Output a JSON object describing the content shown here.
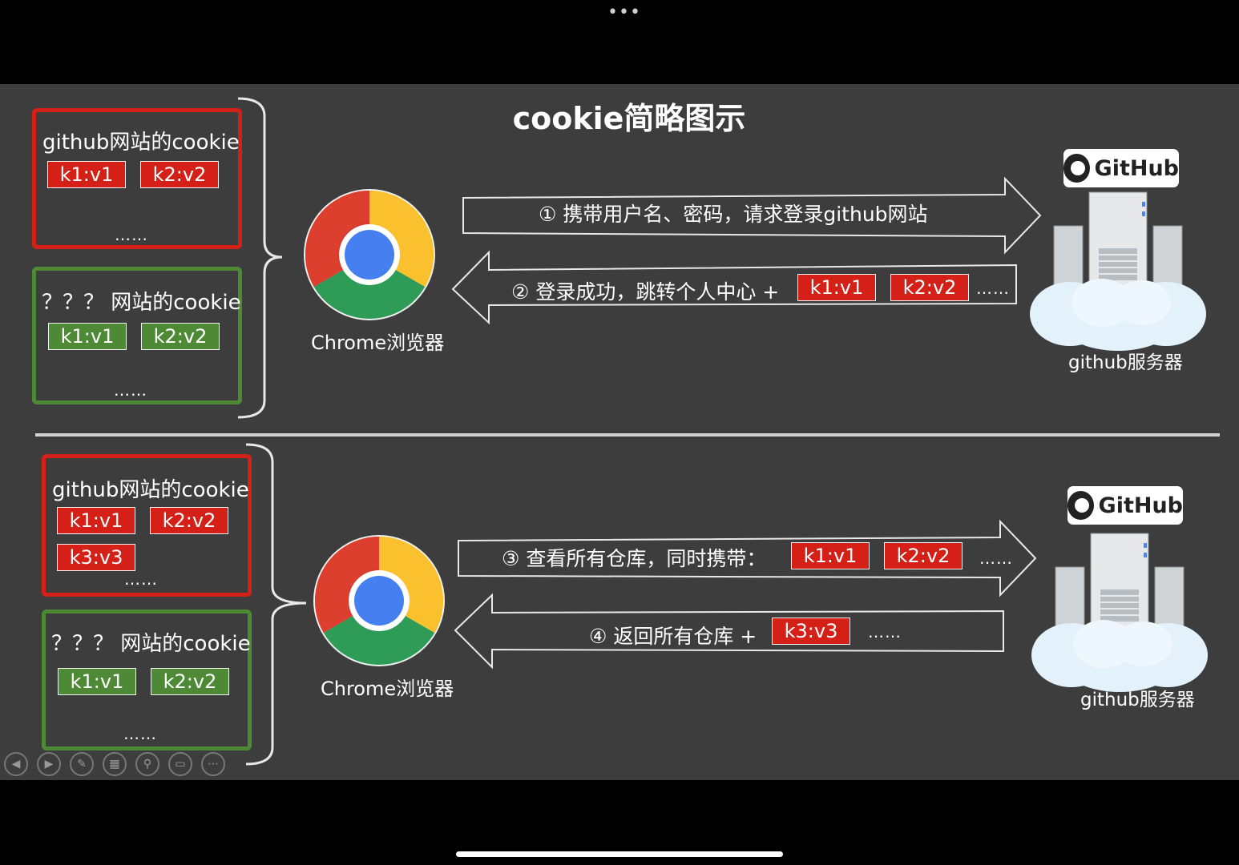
{
  "header": {
    "dots": "•••"
  },
  "slide": {
    "title": "cookie简略图示"
  },
  "top": {
    "github_cookie": {
      "label": "github网站的cookie",
      "tags": [
        "k1:v1",
        "k2:v2"
      ],
      "more": "……"
    },
    "other_cookie": {
      "label": "？？？ 网站的cookie",
      "tags": [
        "k1:v1",
        "k2:v2"
      ],
      "more": "……"
    },
    "browser_label": "Chrome浏览器",
    "arrow1": {
      "text": "① 携带用户名、密码，请求登录github网站"
    },
    "arrow2": {
      "text": "② 登录成功，跳转个人中心 +",
      "tags": [
        "k1:v1",
        "k2:v2"
      ],
      "more": "……"
    },
    "github_badge": "GitHub",
    "server_label": "github服务器"
  },
  "bottom": {
    "github_cookie": {
      "label": "github网站的cookie",
      "tags": [
        "k1:v1",
        "k2:v2",
        "k3:v3"
      ],
      "more": "……"
    },
    "other_cookie": {
      "label": "？？？ 网站的cookie",
      "tags": [
        "k1:v1",
        "k2:v2"
      ],
      "more": "……"
    },
    "browser_label": "Chrome浏览器",
    "arrow3": {
      "text": "③ 查看所有仓库，同时携带：",
      "tags": [
        "k1:v1",
        "k2:v2"
      ],
      "more": "……"
    },
    "arrow4": {
      "text": "④ 返回所有仓库 +",
      "tags": [
        "k3:v3"
      ],
      "more": "……"
    },
    "github_badge": "GitHub",
    "server_label": "github服务器"
  },
  "colors": {
    "background": "#3d3d3d",
    "cookie_red": "#d52017",
    "cookie_green": "#4e8a35",
    "frame": "#000000"
  },
  "toolbar": {
    "icons": [
      "prev-icon",
      "next-icon",
      "pen-icon",
      "slides-icon",
      "zoom-icon",
      "subtitle-icon",
      "more-icon"
    ],
    "glyphs": [
      "◀",
      "▶",
      "✎",
      "▦",
      "⚲",
      "▭",
      "⋯"
    ]
  }
}
